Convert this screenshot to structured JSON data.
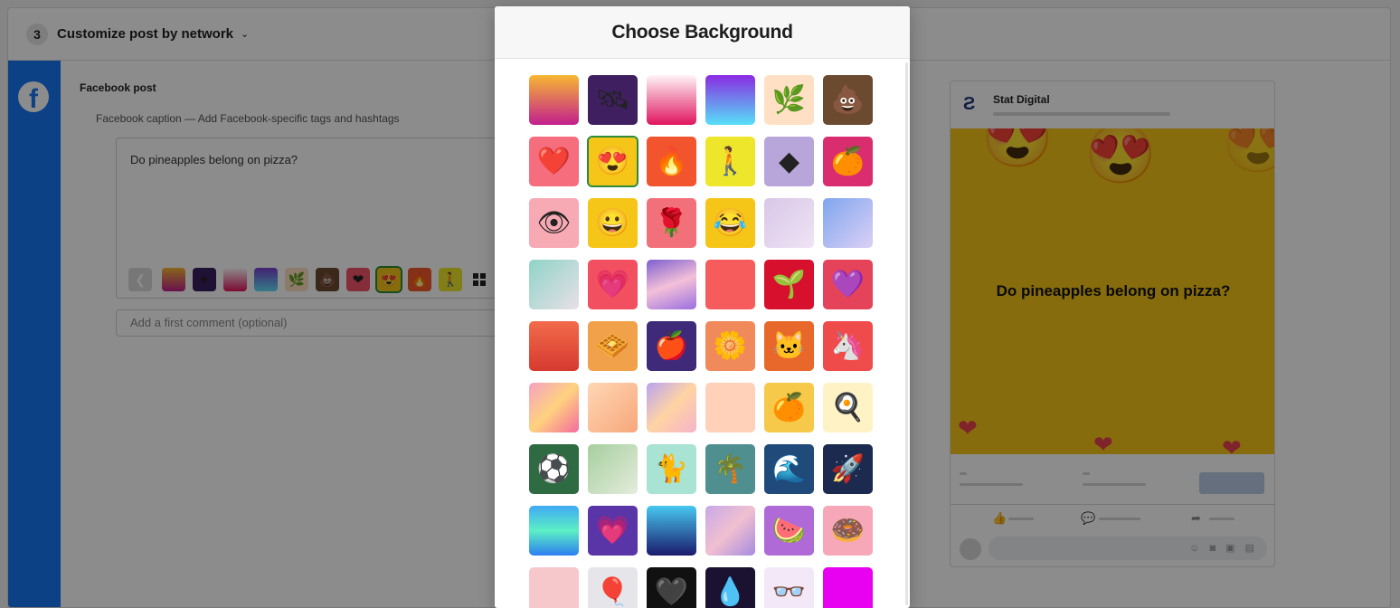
{
  "step": {
    "number": "3",
    "title": "Customize post by network"
  },
  "network": {
    "post_label": "Facebook post",
    "caption_label": "Facebook caption — Add Facebook-specific tags and hashtags",
    "caption_text": "Do pineapples belong on pizza?",
    "comment_placeholder": "Add a first comment (optional)",
    "thumbnails": [
      {
        "name": "thumb-sunset",
        "bg": "linear-gradient(180deg,#f7b733,#c21f8d)",
        "glyph": ""
      },
      {
        "name": "thumb-space",
        "bg": "#3a1f5d",
        "glyph": "✦"
      },
      {
        "name": "thumb-pink",
        "bg": "linear-gradient(180deg,#fff,#e0155e)",
        "glyph": ""
      },
      {
        "name": "thumb-blue-purple",
        "bg": "linear-gradient(180deg,#7b3fd0,#5ee1f7)",
        "glyph": ""
      },
      {
        "name": "thumb-leaf",
        "bg": "#ffe0c4",
        "glyph": "🌿"
      },
      {
        "name": "thumb-poop",
        "bg": "#6b4a30",
        "glyph": "💩"
      },
      {
        "name": "thumb-heart",
        "bg": "#f2546b",
        "glyph": "❤"
      },
      {
        "name": "thumb-heart-eyes",
        "bg": "#f5c518",
        "glyph": "😍",
        "selected": true
      },
      {
        "name": "thumb-fire",
        "bg": "#f25a2a",
        "glyph": "🔥"
      },
      {
        "name": "thumb-figure",
        "bg": "#ede62b",
        "glyph": "🚶"
      }
    ]
  },
  "modal": {
    "title": "Choose Background",
    "tiles": [
      {
        "name": "bg-sunset-gradient",
        "bg": "linear-gradient(180deg,#f7b733,#c21f8d)",
        "glyph": ""
      },
      {
        "name": "bg-space",
        "bg": "#3f1f5f",
        "glyph": "🛰"
      },
      {
        "name": "bg-pink-gradient",
        "bg": "linear-gradient(180deg,#fff4f7,#e0155e)",
        "glyph": ""
      },
      {
        "name": "bg-purple-blue-gradient",
        "bg": "linear-gradient(180deg,#8a2be2,#56e0f7)",
        "glyph": ""
      },
      {
        "name": "bg-palm-leaf",
        "bg": "#ffe0c4",
        "glyph": "🌿"
      },
      {
        "name": "bg-poop",
        "bg": "#6b4a30",
        "glyph": "💩"
      },
      {
        "name": "bg-heart",
        "bg": "#f66d7e",
        "glyph": "❤️"
      },
      {
        "name": "bg-heart-eyes",
        "bg": "#f5c518",
        "glyph": "😍",
        "selected": true
      },
      {
        "name": "bg-fire",
        "bg": "#f2542d",
        "glyph": "🔥"
      },
      {
        "name": "bg-walking-figure",
        "bg": "#ede62b",
        "glyph": "🚶"
      },
      {
        "name": "bg-lavender-cube",
        "bg": "#b8a5d9",
        "glyph": "◆"
      },
      {
        "name": "bg-orange-fruit",
        "bg": "#d92d6f",
        "glyph": "🍊"
      },
      {
        "name": "bg-eye",
        "bg": "#f7a9b4",
        "glyph": "👁"
      },
      {
        "name": "bg-grinning",
        "bg": "#f5c518",
        "glyph": "😀"
      },
      {
        "name": "bg-rose",
        "bg": "#f2707a",
        "glyph": "🌹"
      },
      {
        "name": "bg-laughing",
        "bg": "#f5c518",
        "glyph": "😂"
      },
      {
        "name": "bg-lilac-gradient",
        "bg": "linear-gradient(135deg,#d9c6e8,#efe4f4)",
        "glyph": ""
      },
      {
        "name": "bg-blue-gradient",
        "bg": "linear-gradient(135deg,#7fa6ef,#dcd0f5)",
        "glyph": ""
      },
      {
        "name": "bg-mint-gradient",
        "bg": "linear-gradient(135deg,#8fd3c8,#e8e0e6)",
        "glyph": ""
      },
      {
        "name": "bg-pink-heart",
        "bg": "#f25060",
        "glyph": "💗"
      },
      {
        "name": "bg-swirl",
        "bg": "linear-gradient(160deg,#7d5fd0,#f4c0d8,#9a6fe0)",
        "glyph": ""
      },
      {
        "name": "bg-coral",
        "bg": "#f75c5c",
        "glyph": ""
      },
      {
        "name": "bg-red-branch",
        "bg": "#d6102d",
        "glyph": "🌱"
      },
      {
        "name": "bg-pink-heart-purple",
        "bg": "#e5435a",
        "glyph": "💜"
      },
      {
        "name": "bg-red-ball",
        "bg": "linear-gradient(180deg,#f26b4b,#d63a2f)",
        "glyph": ""
      },
      {
        "name": "bg-waffle",
        "bg": "#f2a14b",
        "glyph": "🧇"
      },
      {
        "name": "bg-apple",
        "bg": "#3f2a7a",
        "glyph": "🍎"
      },
      {
        "name": "bg-yellow-flower",
        "bg": "#f08a5a",
        "glyph": "🌼"
      },
      {
        "name": "bg-cat",
        "bg": "#e8672a",
        "glyph": "🐱"
      },
      {
        "name": "bg-unicorn",
        "bg": "#f04b4b",
        "glyph": "🦄"
      },
      {
        "name": "bg-holo-gradient",
        "bg": "linear-gradient(135deg,#f5a2c0,#ffd27f,#f46b9d)",
        "glyph": ""
      },
      {
        "name": "bg-peach-stairs",
        "bg": "linear-gradient(135deg,#ffd7b5,#f7a77a)",
        "glyph": ""
      },
      {
        "name": "bg-pastel-swirl",
        "bg": "linear-gradient(135deg,#b9a3f2,#ffd4a3,#f5b3c9)",
        "glyph": ""
      },
      {
        "name": "bg-peach-room",
        "bg": "#ffd1b8",
        "glyph": ""
      },
      {
        "name": "bg-orange-slice",
        "bg": "#f7c94a",
        "glyph": "🍊"
      },
      {
        "name": "bg-cream-egg",
        "bg": "#fff3c6",
        "glyph": "🍳"
      },
      {
        "name": "bg-soccer-ball",
        "bg": "#2e6b42",
        "glyph": "⚽"
      },
      {
        "name": "bg-sage-gradient",
        "bg": "linear-gradient(135deg,#a6cf9e,#e4ecdc)",
        "glyph": ""
      },
      {
        "name": "bg-mint-cat",
        "bg": "#a8e3d3",
        "glyph": "🐈"
      },
      {
        "name": "bg-teal-plant",
        "bg": "#4f8f90",
        "glyph": "🌴"
      },
      {
        "name": "bg-navy-waves",
        "bg": "#1f4a7a",
        "glyph": "🌊"
      },
      {
        "name": "bg-rocket",
        "bg": "#1c2a4f",
        "glyph": "🚀"
      },
      {
        "name": "bg-aqua-gradient",
        "bg": "linear-gradient(180deg,#3fa9f5,#5bf0c4,#2d7ef0)",
        "glyph": ""
      },
      {
        "name": "bg-purple-heart",
        "bg": "#5a35a8",
        "glyph": "💗"
      },
      {
        "name": "bg-cyan-navy-gradient",
        "bg": "linear-gradient(180deg,#47c8f0,#1a1a6b)",
        "glyph": ""
      },
      {
        "name": "bg-ribbon",
        "bg": "linear-gradient(135deg,#c8a8e8,#f0c0d0,#a68ae0)",
        "glyph": ""
      },
      {
        "name": "bg-watermelon",
        "bg": "#b06ad8",
        "glyph": "🍉"
      },
      {
        "name": "bg-donut",
        "bg": "#f7a8b8",
        "glyph": "🍩"
      },
      {
        "name": "bg-pale-pink",
        "bg": "#f6c8cc",
        "glyph": ""
      },
      {
        "name": "bg-balloons",
        "bg": "#e6e6ea",
        "glyph": "🎈"
      },
      {
        "name": "bg-black-heart",
        "bg": "#111",
        "glyph": "🖤"
      },
      {
        "name": "bg-dark-purple",
        "bg": "#1a1230",
        "glyph": "💧"
      },
      {
        "name": "bg-glasses",
        "bg": "#f3e8f8",
        "glyph": "👓"
      },
      {
        "name": "bg-magenta",
        "bg": "#e800f0",
        "glyph": ""
      }
    ]
  },
  "preview": {
    "page_name": "Stat Digital",
    "post_text": "Do pineapples belong on pizza?",
    "image_bg": "#f5c518"
  },
  "colors": {
    "facebook_blue": "#1877f2",
    "selected_outline": "#2c8a3a"
  }
}
